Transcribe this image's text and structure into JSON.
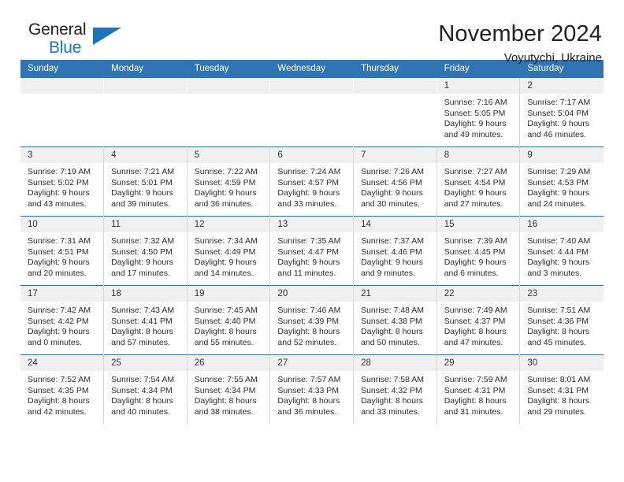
{
  "brand": {
    "word_one": "General",
    "word_two": "Blue",
    "triangle_icon": "triangle-icon"
  },
  "header": {
    "title": "November 2024",
    "location": "Voyutychi, Ukraine"
  },
  "colors": {
    "header_blue": "#3074b4",
    "brand_blue": "#1b75bb",
    "daynum_bg": "#f0f0f0",
    "cell_border": "#d8d8d8"
  },
  "weekday_headers": [
    "Sunday",
    "Monday",
    "Tuesday",
    "Wednesday",
    "Thursday",
    "Friday",
    "Saturday"
  ],
  "weeks": [
    [
      {
        "day": "",
        "blank": true
      },
      {
        "day": "",
        "blank": true
      },
      {
        "day": "",
        "blank": true
      },
      {
        "day": "",
        "blank": true
      },
      {
        "day": "",
        "blank": true
      },
      {
        "day": "1",
        "sunrise": "Sunrise: 7:16 AM",
        "sunset": "Sunset: 5:05 PM",
        "daylight_a": "Daylight: 9 hours",
        "daylight_b": "and 49 minutes."
      },
      {
        "day": "2",
        "sunrise": "Sunrise: 7:17 AM",
        "sunset": "Sunset: 5:04 PM",
        "daylight_a": "Daylight: 9 hours",
        "daylight_b": "and 46 minutes."
      }
    ],
    [
      {
        "day": "3",
        "sunrise": "Sunrise: 7:19 AM",
        "sunset": "Sunset: 5:02 PM",
        "daylight_a": "Daylight: 9 hours",
        "daylight_b": "and 43 minutes."
      },
      {
        "day": "4",
        "sunrise": "Sunrise: 7:21 AM",
        "sunset": "Sunset: 5:01 PM",
        "daylight_a": "Daylight: 9 hours",
        "daylight_b": "and 39 minutes."
      },
      {
        "day": "5",
        "sunrise": "Sunrise: 7:22 AM",
        "sunset": "Sunset: 4:59 PM",
        "daylight_a": "Daylight: 9 hours",
        "daylight_b": "and 36 minutes."
      },
      {
        "day": "6",
        "sunrise": "Sunrise: 7:24 AM",
        "sunset": "Sunset: 4:57 PM",
        "daylight_a": "Daylight: 9 hours",
        "daylight_b": "and 33 minutes."
      },
      {
        "day": "7",
        "sunrise": "Sunrise: 7:26 AM",
        "sunset": "Sunset: 4:56 PM",
        "daylight_a": "Daylight: 9 hours",
        "daylight_b": "and 30 minutes."
      },
      {
        "day": "8",
        "sunrise": "Sunrise: 7:27 AM",
        "sunset": "Sunset: 4:54 PM",
        "daylight_a": "Daylight: 9 hours",
        "daylight_b": "and 27 minutes."
      },
      {
        "day": "9",
        "sunrise": "Sunrise: 7:29 AM",
        "sunset": "Sunset: 4:53 PM",
        "daylight_a": "Daylight: 9 hours",
        "daylight_b": "and 24 minutes."
      }
    ],
    [
      {
        "day": "10",
        "sunrise": "Sunrise: 7:31 AM",
        "sunset": "Sunset: 4:51 PM",
        "daylight_a": "Daylight: 9 hours",
        "daylight_b": "and 20 minutes."
      },
      {
        "day": "11",
        "sunrise": "Sunrise: 7:32 AM",
        "sunset": "Sunset: 4:50 PM",
        "daylight_a": "Daylight: 9 hours",
        "daylight_b": "and 17 minutes."
      },
      {
        "day": "12",
        "sunrise": "Sunrise: 7:34 AM",
        "sunset": "Sunset: 4:49 PM",
        "daylight_a": "Daylight: 9 hours",
        "daylight_b": "and 14 minutes."
      },
      {
        "day": "13",
        "sunrise": "Sunrise: 7:35 AM",
        "sunset": "Sunset: 4:47 PM",
        "daylight_a": "Daylight: 9 hours",
        "daylight_b": "and 11 minutes."
      },
      {
        "day": "14",
        "sunrise": "Sunrise: 7:37 AM",
        "sunset": "Sunset: 4:46 PM",
        "daylight_a": "Daylight: 9 hours",
        "daylight_b": "and 9 minutes."
      },
      {
        "day": "15",
        "sunrise": "Sunrise: 7:39 AM",
        "sunset": "Sunset: 4:45 PM",
        "daylight_a": "Daylight: 9 hours",
        "daylight_b": "and 6 minutes."
      },
      {
        "day": "16",
        "sunrise": "Sunrise: 7:40 AM",
        "sunset": "Sunset: 4:44 PM",
        "daylight_a": "Daylight: 9 hours",
        "daylight_b": "and 3 minutes."
      }
    ],
    [
      {
        "day": "17",
        "sunrise": "Sunrise: 7:42 AM",
        "sunset": "Sunset: 4:42 PM",
        "daylight_a": "Daylight: 9 hours",
        "daylight_b": "and 0 minutes."
      },
      {
        "day": "18",
        "sunrise": "Sunrise: 7:43 AM",
        "sunset": "Sunset: 4:41 PM",
        "daylight_a": "Daylight: 8 hours",
        "daylight_b": "and 57 minutes."
      },
      {
        "day": "19",
        "sunrise": "Sunrise: 7:45 AM",
        "sunset": "Sunset: 4:40 PM",
        "daylight_a": "Daylight: 8 hours",
        "daylight_b": "and 55 minutes."
      },
      {
        "day": "20",
        "sunrise": "Sunrise: 7:46 AM",
        "sunset": "Sunset: 4:39 PM",
        "daylight_a": "Daylight: 8 hours",
        "daylight_b": "and 52 minutes."
      },
      {
        "day": "21",
        "sunrise": "Sunrise: 7:48 AM",
        "sunset": "Sunset: 4:38 PM",
        "daylight_a": "Daylight: 8 hours",
        "daylight_b": "and 50 minutes."
      },
      {
        "day": "22",
        "sunrise": "Sunrise: 7:49 AM",
        "sunset": "Sunset: 4:37 PM",
        "daylight_a": "Daylight: 8 hours",
        "daylight_b": "and 47 minutes."
      },
      {
        "day": "23",
        "sunrise": "Sunrise: 7:51 AM",
        "sunset": "Sunset: 4:36 PM",
        "daylight_a": "Daylight: 8 hours",
        "daylight_b": "and 45 minutes."
      }
    ],
    [
      {
        "day": "24",
        "sunrise": "Sunrise: 7:52 AM",
        "sunset": "Sunset: 4:35 PM",
        "daylight_a": "Daylight: 8 hours",
        "daylight_b": "and 42 minutes."
      },
      {
        "day": "25",
        "sunrise": "Sunrise: 7:54 AM",
        "sunset": "Sunset: 4:34 PM",
        "daylight_a": "Daylight: 8 hours",
        "daylight_b": "and 40 minutes."
      },
      {
        "day": "26",
        "sunrise": "Sunrise: 7:55 AM",
        "sunset": "Sunset: 4:34 PM",
        "daylight_a": "Daylight: 8 hours",
        "daylight_b": "and 38 minutes."
      },
      {
        "day": "27",
        "sunrise": "Sunrise: 7:57 AM",
        "sunset": "Sunset: 4:33 PM",
        "daylight_a": "Daylight: 8 hours",
        "daylight_b": "and 36 minutes."
      },
      {
        "day": "28",
        "sunrise": "Sunrise: 7:58 AM",
        "sunset": "Sunset: 4:32 PM",
        "daylight_a": "Daylight: 8 hours",
        "daylight_b": "and 33 minutes."
      },
      {
        "day": "29",
        "sunrise": "Sunrise: 7:59 AM",
        "sunset": "Sunset: 4:31 PM",
        "daylight_a": "Daylight: 8 hours",
        "daylight_b": "and 31 minutes."
      },
      {
        "day": "30",
        "sunrise": "Sunrise: 8:01 AM",
        "sunset": "Sunset: 4:31 PM",
        "daylight_a": "Daylight: 8 hours",
        "daylight_b": "and 29 minutes."
      }
    ]
  ]
}
